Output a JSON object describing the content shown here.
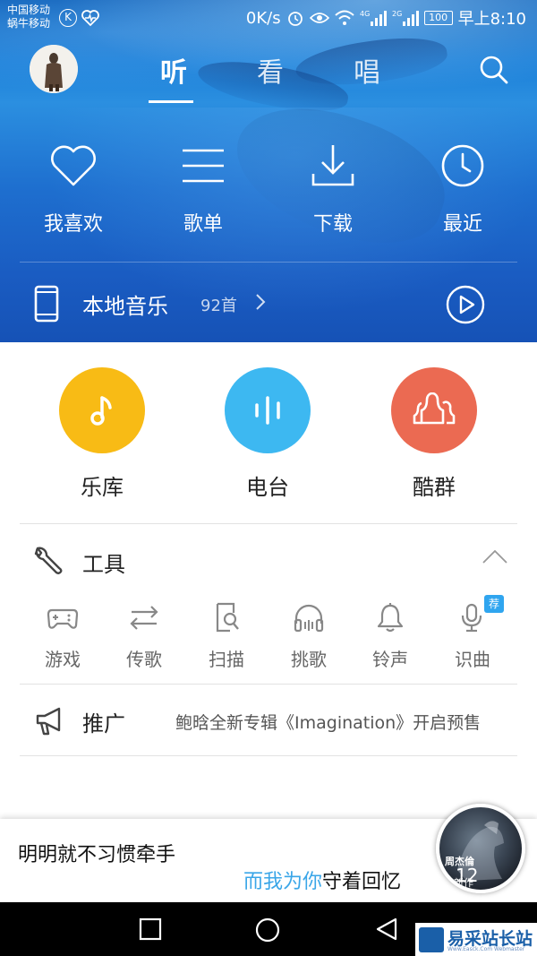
{
  "status_bar": {
    "carrier_line1": "中国移动",
    "carrier_line2": "蜗牛移动",
    "carrier_badge": "K",
    "speed": "0K/s",
    "network_4g": "4G",
    "network_2g": "2G",
    "battery": "100",
    "time": "早上8:10"
  },
  "header": {
    "tabs": [
      {
        "label": "听",
        "active": true
      },
      {
        "label": "看",
        "active": false
      },
      {
        "label": "唱",
        "active": false
      }
    ]
  },
  "quick_actions": [
    {
      "label": "我喜欢",
      "icon": "heart-icon"
    },
    {
      "label": "歌单",
      "icon": "list-icon"
    },
    {
      "label": "下载",
      "icon": "download-icon"
    },
    {
      "label": "最近",
      "icon": "clock-icon"
    }
  ],
  "local_music": {
    "title": "本地音乐",
    "count": "92首"
  },
  "categories": [
    {
      "label": "乐库",
      "color": "#f8bb15",
      "icon": "music-note-icon"
    },
    {
      "label": "电台",
      "color": "#3db8f1",
      "icon": "radio-bars-icon"
    },
    {
      "label": "酷群",
      "color": "#eb6a52",
      "icon": "group-icon"
    }
  ],
  "tools": {
    "title": "工具",
    "badge": "荐",
    "items": [
      {
        "label": "游戏",
        "icon": "gamepad-icon"
      },
      {
        "label": "传歌",
        "icon": "transfer-icon"
      },
      {
        "label": "扫描",
        "icon": "scan-icon"
      },
      {
        "label": "挑歌",
        "icon": "headphones-icon"
      },
      {
        "label": "铃声",
        "icon": "bell-icon"
      },
      {
        "label": "识曲",
        "icon": "mic-icon"
      }
    ]
  },
  "promo": {
    "title": "推广",
    "ticker": "鲍晗全新专辑《Imagination》开启预售"
  },
  "player": {
    "lyric_line1": "明明就不习惯牵手",
    "lyric_line2_highlight": "而我为你",
    "lyric_line2_rest": "守着回忆",
    "cover_text1": "周杰倫",
    "cover_text2": "12",
    "cover_text3": "新作"
  },
  "watermark": {
    "text": "易采站长站",
    "sub": "Www.Easck.Com Webmaster"
  },
  "colors": {
    "accent_blue": "#3aa6e8",
    "hero_blue": "#1b74d4"
  }
}
